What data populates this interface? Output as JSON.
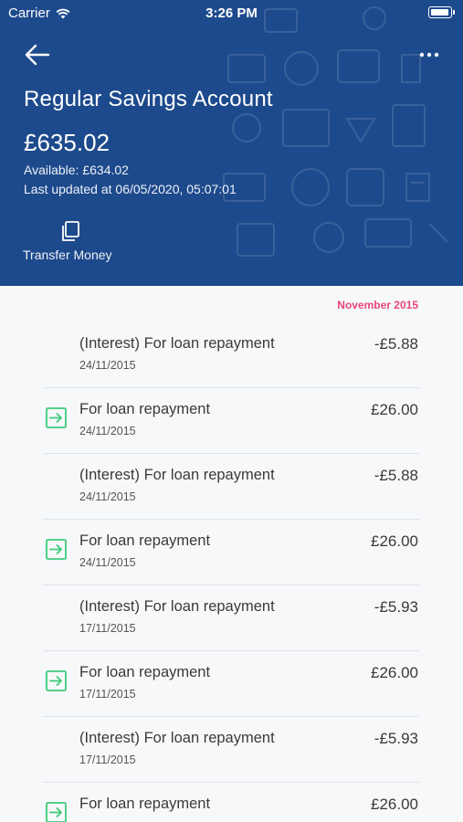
{
  "status_bar": {
    "carrier": "Carrier",
    "time": "3:26 PM"
  },
  "account": {
    "title": "Regular Savings Account",
    "balance": "£635.02",
    "available": "Available: £634.02",
    "last_updated": "Last updated at 06/05/2020, 05:07:01"
  },
  "actions": {
    "transfer_label": "Transfer Money"
  },
  "month": "November 2015",
  "colors": {
    "header_bg": "#1d4a8c",
    "month_accent": "#e8457c",
    "incoming_icon": "#3ecb7a"
  },
  "transactions": [
    {
      "title": "(Interest) For loan repayment",
      "date": "24/11/2015",
      "amount": "-£5.88",
      "icon": ""
    },
    {
      "title": "For loan repayment",
      "date": "24/11/2015",
      "amount": "£26.00",
      "icon": "arrow-in-icon"
    },
    {
      "title": "(Interest) For loan repayment",
      "date": "24/11/2015",
      "amount": "-£5.88",
      "icon": ""
    },
    {
      "title": "For loan repayment",
      "date": "24/11/2015",
      "amount": "£26.00",
      "icon": "arrow-in-icon"
    },
    {
      "title": "(Interest) For loan repayment",
      "date": "17/11/2015",
      "amount": "-£5.93",
      "icon": ""
    },
    {
      "title": "For loan repayment",
      "date": "17/11/2015",
      "amount": "£26.00",
      "icon": "arrow-in-icon"
    },
    {
      "title": "(Interest) For loan repayment",
      "date": "17/11/2015",
      "amount": "-£5.93",
      "icon": ""
    },
    {
      "title": "For loan repayment",
      "date": "",
      "amount": "£26.00",
      "icon": "arrow-in-icon"
    }
  ]
}
